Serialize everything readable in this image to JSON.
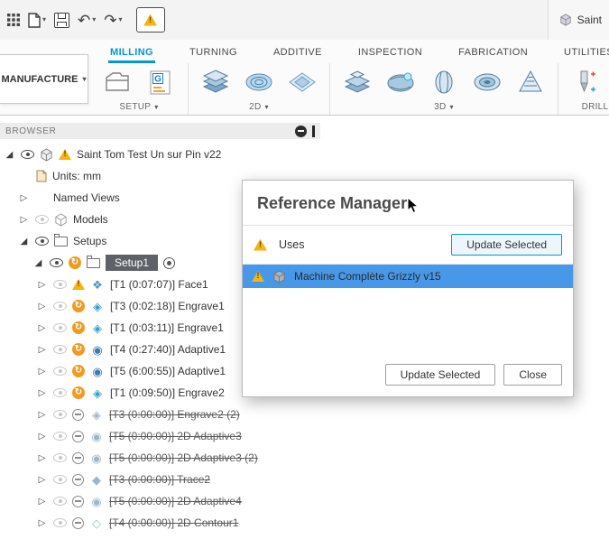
{
  "window": {
    "doc_tab": "Saint"
  },
  "ribbon": {
    "workspace": "MANUFACTURE",
    "tabs": [
      {
        "label": "MILLING",
        "active": true
      },
      {
        "label": "TURNING",
        "active": false
      },
      {
        "label": "ADDITIVE",
        "active": false
      },
      {
        "label": "INSPECTION",
        "active": false
      },
      {
        "label": "FABRICATION",
        "active": false
      },
      {
        "label": "UTILITIES",
        "active": false
      }
    ],
    "groups": [
      {
        "label": "SETUP"
      },
      {
        "label": "2D"
      },
      {
        "label": "3D"
      },
      {
        "label": "DRILLING"
      }
    ]
  },
  "browser": {
    "header": "BROWSER",
    "root_label": "Saint Tom Test Un sur Pin v22",
    "units_label": "Units: mm",
    "named_views_label": "Named Views",
    "models_label": "Models",
    "setups_label": "Setups",
    "setup1_label": "Setup1",
    "operations": [
      {
        "label": "[T1 (0:07:07)] Face1"
      },
      {
        "label": "[T3 (0:02:18)] Engrave1"
      },
      {
        "label": "[T1 (0:03:11)] Engrave1"
      },
      {
        "label": "[T4 (0:27:40)] Adaptive1"
      },
      {
        "label": "[T5 (6:00:55)] Adaptive1"
      },
      {
        "label": "[T1 (0:09:50)] Engrave2"
      },
      {
        "label": "[T3 (0:00:00)] Engrave2 (2)"
      },
      {
        "label": "[T5 (0:00:00)] 2D Adaptive3"
      },
      {
        "label": "[T5 (0:00:00)] 2D Adaptive3 (2)"
      },
      {
        "label": "[T3 (0:00:00)] Trace2"
      },
      {
        "label": "[T5 (0:00:00)] 2D Adaptive4"
      },
      {
        "label": "[T4 (0:00:00)] 2D Contour1"
      }
    ]
  },
  "dialog": {
    "title": "Reference Manager",
    "uses_label": "Uses",
    "update_selected_header": "Update Selected",
    "reference_item": "Machine Complète Grizzly v15",
    "update_selected_button": "Update Selected",
    "close_button": "Close"
  },
  "colors": {
    "accent": "#0696d7",
    "selection": "#4798e8",
    "warning": "#f6b40e"
  }
}
